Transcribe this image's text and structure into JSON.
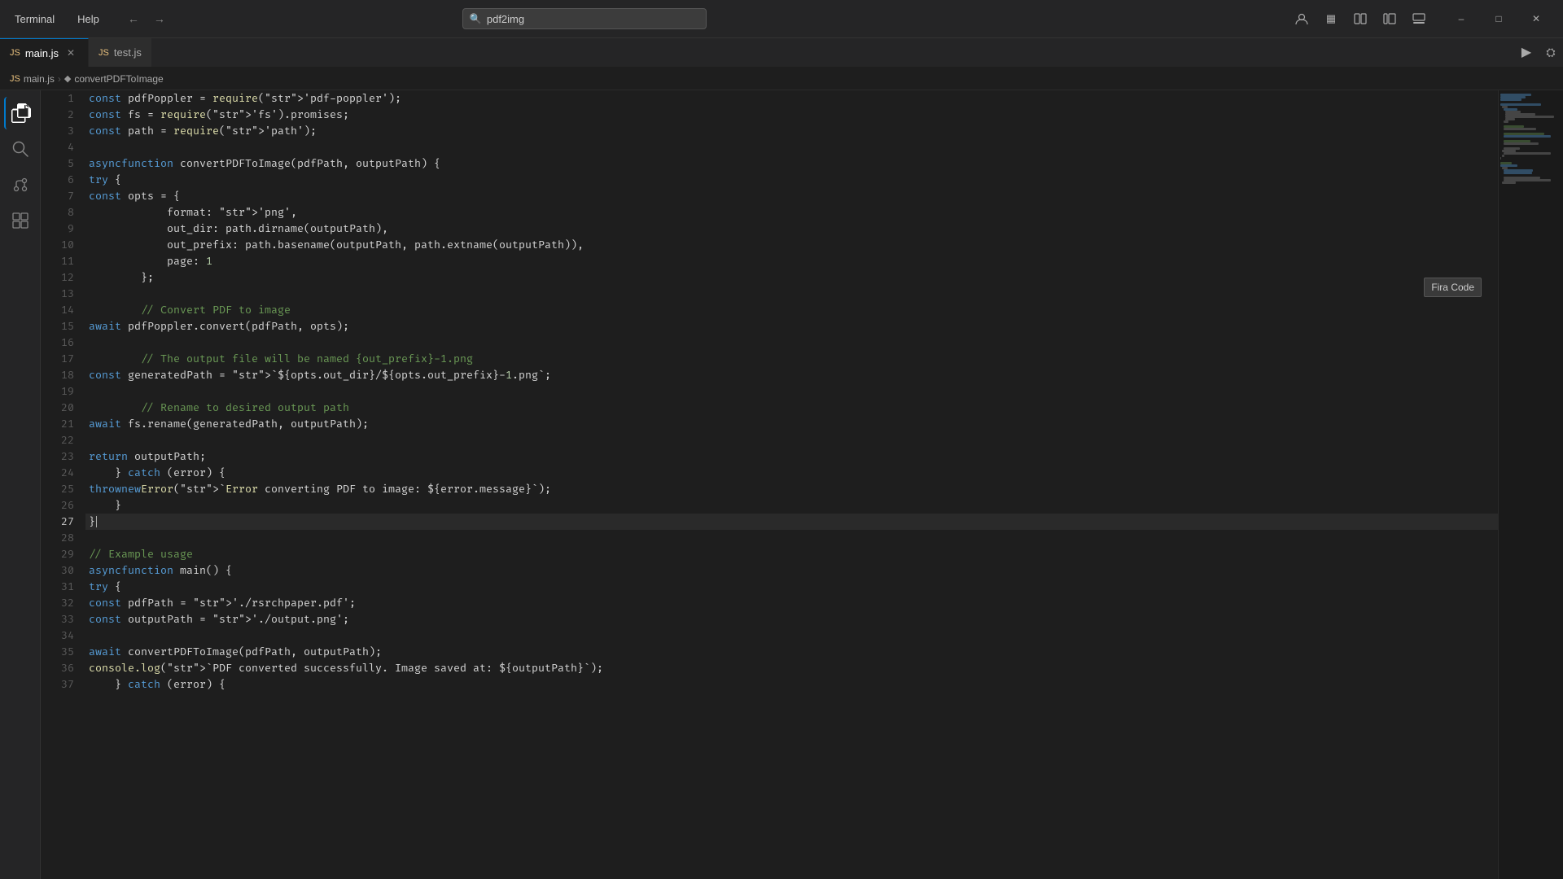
{
  "titleBar": {
    "menus": [
      "Terminal",
      "Help"
    ],
    "searchPlaceholder": "pdf2img",
    "navBack": "←",
    "navForward": "→"
  },
  "tabs": [
    {
      "id": "main-js",
      "label": "main.js",
      "active": true,
      "icon": "JS"
    },
    {
      "id": "test-js",
      "label": "test.js",
      "active": false,
      "icon": "JS"
    }
  ],
  "breadcrumb": {
    "items": [
      "main.js",
      "convertPDFToImage"
    ]
  },
  "editor": {
    "fontTooltip": "Fira Code",
    "lines": [
      {
        "num": 1,
        "code": "const pdfPoppler = require('pdf-poppler');"
      },
      {
        "num": 2,
        "code": "const fs = require('fs').promises;"
      },
      {
        "num": 3,
        "code": "const path = require('path');"
      },
      {
        "num": 4,
        "code": ""
      },
      {
        "num": 5,
        "code": "async function convertPDFToImage(pdfPath, outputPath) {"
      },
      {
        "num": 6,
        "code": "    try {"
      },
      {
        "num": 7,
        "code": "        const opts = {"
      },
      {
        "num": 8,
        "code": "            format: 'png',"
      },
      {
        "num": 9,
        "code": "            out_dir: path.dirname(outputPath),"
      },
      {
        "num": 10,
        "code": "            out_prefix: path.basename(outputPath, path.extname(outputPath)),"
      },
      {
        "num": 11,
        "code": "            page: 1"
      },
      {
        "num": 12,
        "code": "        };"
      },
      {
        "num": 13,
        "code": ""
      },
      {
        "num": 14,
        "code": "        // Convert PDF to image"
      },
      {
        "num": 15,
        "code": "        await pdfPoppler.convert(pdfPath, opts);"
      },
      {
        "num": 16,
        "code": ""
      },
      {
        "num": 17,
        "code": "        // The output file will be named {out_prefix}-1.png"
      },
      {
        "num": 18,
        "code": "        const generatedPath = `${opts.out_dir}/${opts.out_prefix}-1.png`;"
      },
      {
        "num": 19,
        "code": ""
      },
      {
        "num": 20,
        "code": "        // Rename to desired output path"
      },
      {
        "num": 21,
        "code": "        await fs.rename(generatedPath, outputPath);"
      },
      {
        "num": 22,
        "code": ""
      },
      {
        "num": 23,
        "code": "        return outputPath;"
      },
      {
        "num": 24,
        "code": "    } catch (error) {"
      },
      {
        "num": 25,
        "code": "        throw new Error(`Error converting PDF to image: ${error.message}`);"
      },
      {
        "num": 26,
        "code": "    }"
      },
      {
        "num": 27,
        "code": "}"
      },
      {
        "num": 28,
        "code": ""
      },
      {
        "num": 29,
        "code": "// Example usage"
      },
      {
        "num": 30,
        "code": "async function main() {"
      },
      {
        "num": 31,
        "code": "    try {"
      },
      {
        "num": 32,
        "code": "        const pdfPath = './rsrchpaper.pdf';"
      },
      {
        "num": 33,
        "code": "        const outputPath = './output.png';"
      },
      {
        "num": 34,
        "code": ""
      },
      {
        "num": 35,
        "code": "        await convertPDFToImage(pdfPath, outputPath);"
      },
      {
        "num": 36,
        "code": "        console.log(`PDF converted successfully. Image saved at: ${outputPath}`);"
      },
      {
        "num": 37,
        "code": "    } catch (error) {"
      }
    ]
  }
}
